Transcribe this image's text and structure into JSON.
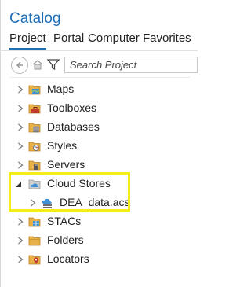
{
  "catalog": {
    "title": "Catalog",
    "tabs": [
      {
        "label": "Project",
        "active": true
      },
      {
        "label": "Portal",
        "active": false
      },
      {
        "label": "Computer",
        "active": false
      },
      {
        "label": "Favorites",
        "active": false
      }
    ]
  },
  "toolbar": {
    "buttons": [
      "back-icon",
      "home-icon",
      "filter-icon"
    ],
    "search_placeholder": "Search Project"
  },
  "tree": {
    "items": [
      {
        "label": "Maps",
        "icon": "maps-folder-icon",
        "expanded": false
      },
      {
        "label": "Toolboxes",
        "icon": "toolbox-folder-icon",
        "expanded": false
      },
      {
        "label": "Databases",
        "icon": "database-folder-icon",
        "expanded": false
      },
      {
        "label": "Styles",
        "icon": "styles-folder-icon",
        "expanded": false
      },
      {
        "label": "Servers",
        "icon": "servers-folder-icon",
        "expanded": false
      },
      {
        "label": "Cloud Stores",
        "icon": "cloud-stores-folder-icon",
        "expanded": true
      },
      {
        "label": "DEA_data.acs",
        "icon": "cloud-connection-icon",
        "expanded": false,
        "child": true
      },
      {
        "label": "STACs",
        "icon": "stacs-folder-icon",
        "expanded": false
      },
      {
        "label": "Folders",
        "icon": "folders-icon",
        "expanded": false
      },
      {
        "label": "Locators",
        "icon": "locators-folder-icon",
        "expanded": false
      }
    ]
  },
  "colors": {
    "accent": "#1f6fb5",
    "highlight": "#f4ed18",
    "folder": "#e8b04a"
  }
}
